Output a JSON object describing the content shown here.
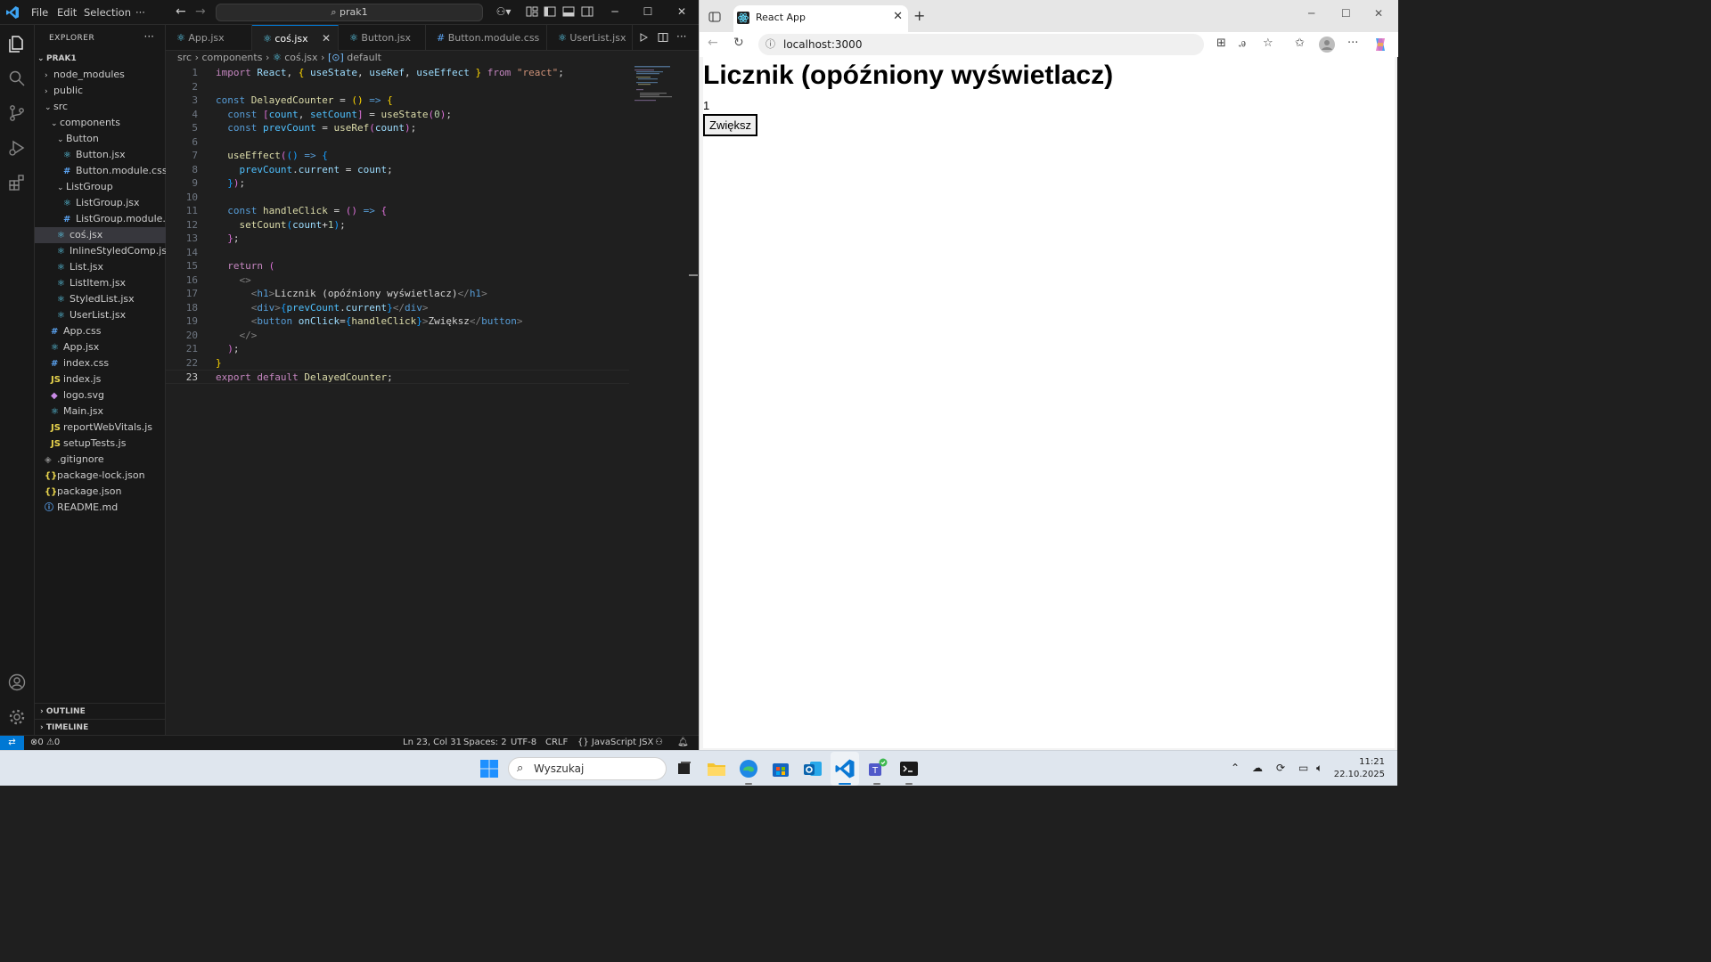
{
  "vscode": {
    "menu": [
      "File",
      "Edit",
      "Selection"
    ],
    "menu_more": "···",
    "command_center": "prak1",
    "explorer_title": "EXPLORER",
    "explorer_more": "···",
    "project": "PRAK1",
    "tree": [
      {
        "label": "node_modules",
        "depth": 1,
        "type": "folder",
        "open": false
      },
      {
        "label": "public",
        "depth": 1,
        "type": "folder",
        "open": false
      },
      {
        "label": "src",
        "depth": 1,
        "type": "folder",
        "open": true
      },
      {
        "label": "components",
        "depth": 2,
        "type": "folder",
        "open": true
      },
      {
        "label": "Button",
        "depth": 3,
        "type": "folder",
        "open": true
      },
      {
        "label": "Button.jsx",
        "depth": 4,
        "type": "react"
      },
      {
        "label": "Button.module.css",
        "depth": 4,
        "type": "css"
      },
      {
        "label": "ListGroup",
        "depth": 3,
        "type": "folder",
        "open": true
      },
      {
        "label": "ListGroup.jsx",
        "depth": 4,
        "type": "react"
      },
      {
        "label": "ListGroup.module.c...",
        "depth": 4,
        "type": "css"
      },
      {
        "label": "coś.jsx",
        "depth": 3,
        "type": "react",
        "selected": true
      },
      {
        "label": "InlineStyledComp.jsx",
        "depth": 3,
        "type": "react"
      },
      {
        "label": "List.jsx",
        "depth": 3,
        "type": "react"
      },
      {
        "label": "ListItem.jsx",
        "depth": 3,
        "type": "react"
      },
      {
        "label": "StyledList.jsx",
        "depth": 3,
        "type": "react"
      },
      {
        "label": "UserList.jsx",
        "depth": 3,
        "type": "react"
      },
      {
        "label": "App.css",
        "depth": 2,
        "type": "css"
      },
      {
        "label": "App.jsx",
        "depth": 2,
        "type": "react"
      },
      {
        "label": "index.css",
        "depth": 2,
        "type": "css"
      },
      {
        "label": "index.js",
        "depth": 2,
        "type": "js"
      },
      {
        "label": "logo.svg",
        "depth": 2,
        "type": "svg"
      },
      {
        "label": "Main.jsx",
        "depth": 2,
        "type": "react"
      },
      {
        "label": "reportWebVitals.js",
        "depth": 2,
        "type": "js"
      },
      {
        "label": "setupTests.js",
        "depth": 2,
        "type": "js"
      },
      {
        "label": ".gitignore",
        "depth": 1,
        "type": "git"
      },
      {
        "label": "package-lock.json",
        "depth": 1,
        "type": "json"
      },
      {
        "label": "package.json",
        "depth": 1,
        "type": "json"
      },
      {
        "label": "README.md",
        "depth": 1,
        "type": "info"
      }
    ],
    "outline": "OUTLINE",
    "timeline": "TIMELINE",
    "tabs": [
      {
        "label": "App.jsx",
        "icon": "react"
      },
      {
        "label": "coś.jsx",
        "icon": "react",
        "active": true
      },
      {
        "label": "Button.jsx",
        "icon": "react"
      },
      {
        "label": "Button.module.css",
        "icon": "css"
      },
      {
        "label": "UserList.jsx",
        "icon": "react"
      }
    ],
    "breadcrumb": [
      "src",
      "components",
      "coś.jsx",
      "default"
    ],
    "status": {
      "errors": "0",
      "warnings": "0",
      "position": "Ln 23, Col 31",
      "spaces": "Spaces: 2",
      "encoding": "UTF-8",
      "eol": "CRLF",
      "language": "JavaScript JSX"
    }
  },
  "browser": {
    "tab_title": "React App",
    "url": "localhost:3000",
    "page": {
      "heading": "Licznik (opóźniony wyświetlacz)",
      "count": "1",
      "button": "Zwiększ"
    }
  },
  "taskbar": {
    "search": "Wyszukaj",
    "time": "11:21",
    "date": "22.10.2025"
  }
}
